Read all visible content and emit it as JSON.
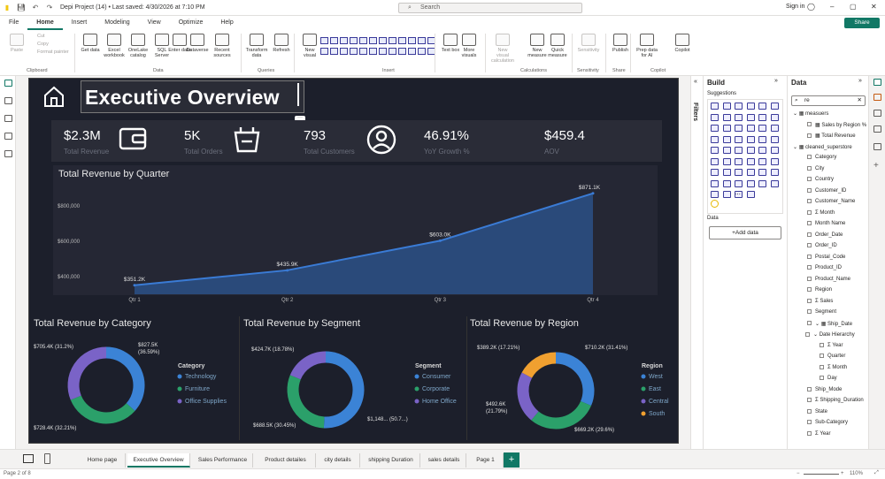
{
  "app": {
    "doc_title": "Depi Project (14) • Last saved: 4/30/2026 at 7:10 PM",
    "search_placeholder": "Search",
    "signin": "Sign in",
    "share": "Share"
  },
  "menu": [
    "File",
    "Home",
    "Insert",
    "Modeling",
    "View",
    "Optimize",
    "Help"
  ],
  "ribbon": {
    "buttons": [
      {
        "label": "Paste",
        "dis": true
      },
      {
        "label": "Cut",
        "dis": true
      },
      {
        "label": "Copy",
        "dis": true
      },
      {
        "label": "Format painter",
        "dis": true
      },
      {
        "label": "Get data",
        "dis": false
      },
      {
        "label": "Excel workbook",
        "dis": false
      },
      {
        "label": "OneLake catalog",
        "dis": false
      },
      {
        "label": "SQL Server",
        "dis": false
      },
      {
        "label": "Enter data",
        "dis": false
      },
      {
        "label": "Dataverse",
        "dis": false
      },
      {
        "label": "Recent sources",
        "dis": false
      },
      {
        "label": "Transform data",
        "dis": false
      },
      {
        "label": "Refresh",
        "dis": false
      },
      {
        "label": "New visual",
        "dis": false
      },
      {
        "label": "Text box",
        "dis": false
      },
      {
        "label": "More visuals",
        "dis": false
      },
      {
        "label": "New visual calculation",
        "dis": true
      },
      {
        "label": "New measure",
        "dis": false
      },
      {
        "label": "Quick measure",
        "dis": false
      },
      {
        "label": "Sensitivity",
        "dis": true
      },
      {
        "label": "Publish",
        "dis": false
      },
      {
        "label": "Prep data for AI",
        "dis": false
      },
      {
        "label": "Copilot",
        "dis": false
      }
    ],
    "groups": [
      "Clipboard",
      "Data",
      "Queries",
      "Insert",
      "Calculations",
      "Sensitivity",
      "Share",
      "Copilot"
    ]
  },
  "report": {
    "title": "Executive Overview",
    "kpis": [
      {
        "value": "$2.3M",
        "label": "Total Revenue",
        "icon": "wallet-icon"
      },
      {
        "value": "5K",
        "label": "Total Orders",
        "icon": "basket-icon"
      },
      {
        "value": "793",
        "label": "Total Customers",
        "icon": "user-icon"
      },
      {
        "value": "46.91%",
        "label": "YoY Growth %"
      },
      {
        "value": "$459.4",
        "label": "AOV"
      }
    ]
  },
  "chart_data": [
    {
      "type": "area",
      "title": "Total Revenue by Quarter",
      "categories": [
        "Qtr 1",
        "Qtr 2",
        "Qtr 3",
        "Qtr 4"
      ],
      "values": [
        351200,
        435900,
        603000,
        871100
      ],
      "data_labels": [
        "$351.2K",
        "$435.9K",
        "$603.0K",
        "$871.1K"
      ],
      "yticks": [
        "$400,000",
        "$600,000",
        "$800,000"
      ],
      "ylim": [
        300000,
        920000
      ],
      "color": "#3a7bd5"
    },
    {
      "type": "pie",
      "title": "Total Revenue by Category",
      "legend_title": "Category",
      "series": [
        {
          "name": "Technology",
          "value": 827500,
          "label": "$827.5K (36.59%)",
          "color": "#3b83d6"
        },
        {
          "name": "Furniture",
          "value": 728400,
          "label": "$728.4K (32.21%)",
          "color": "#2ba06a"
        },
        {
          "name": "Office Supplies",
          "value": 705400,
          "label": "$705.4K (31.2%)",
          "color": "#7a63c7"
        }
      ]
    },
    {
      "type": "pie",
      "title": "Total Revenue by Segment",
      "legend_title": "Segment",
      "series": [
        {
          "name": "Consumer",
          "value": 1148000,
          "label": "$1,148... (50.7...)",
          "color": "#3b83d6"
        },
        {
          "name": "Corporate",
          "value": 688500,
          "label": "$688.5K (30.45%)",
          "color": "#2ba06a"
        },
        {
          "name": "Home Office",
          "value": 424700,
          "label": "$424.7K (18.78%)",
          "color": "#7a63c7"
        }
      ]
    },
    {
      "type": "pie",
      "title": "Total Revenue by Region",
      "legend_title": "Region",
      "series": [
        {
          "name": "West",
          "value": 710200,
          "label": "$710.2K (31.41%)",
          "color": "#3b83d6"
        },
        {
          "name": "East",
          "value": 669200,
          "label": "$669.2K (29.6%)",
          "color": "#2ba06a"
        },
        {
          "name": "Central",
          "value": 492600,
          "label": "$492.6K (21.79%)",
          "color": "#7a63c7"
        },
        {
          "name": "South",
          "value": 389200,
          "label": "$389.2K (17.21%)",
          "color": "#f0a030"
        }
      ]
    }
  ],
  "build": {
    "title": "Build",
    "suggestions": "Suggestions",
    "data_label": "Data",
    "add_data": "+Add data"
  },
  "filters_label": "Filters",
  "data_pane": {
    "title": "Data",
    "search_value": "re",
    "items": [
      {
        "t": "measuers",
        "lvl": 0,
        "kind": "table"
      },
      {
        "t": "Sales by Region %",
        "lvl": 1,
        "kind": "measure"
      },
      {
        "t": "Total Revenue",
        "lvl": 1,
        "kind": "measure"
      },
      {
        "t": "cleaned_superstore",
        "lvl": 0,
        "kind": "table"
      },
      {
        "t": "Category",
        "lvl": 1
      },
      {
        "t": "City",
        "lvl": 1
      },
      {
        "t": "Country",
        "lvl": 1
      },
      {
        "t": "Customer_ID",
        "lvl": 1
      },
      {
        "t": "Customer_Name",
        "lvl": 1
      },
      {
        "t": "Month",
        "lvl": 1,
        "sigma": true
      },
      {
        "t": "Month Name",
        "lvl": 1
      },
      {
        "t": "Order_Date",
        "lvl": 1
      },
      {
        "t": "Order_ID",
        "lvl": 1
      },
      {
        "t": "Postal_Code",
        "lvl": 1
      },
      {
        "t": "Product_ID",
        "lvl": 1
      },
      {
        "t": "Product_Name",
        "lvl": 1
      },
      {
        "t": "Region",
        "lvl": 1
      },
      {
        "t": "Sales",
        "lvl": 1,
        "sigma": true
      },
      {
        "t": "Segment",
        "lvl": 1
      },
      {
        "t": "Ship_Date",
        "lvl": 1,
        "kind": "date"
      },
      {
        "t": "Date Hierarchy",
        "lvl": 2
      },
      {
        "t": "Year",
        "lvl": 3,
        "sigma": true
      },
      {
        "t": "Quarter",
        "lvl": 3
      },
      {
        "t": "Month",
        "lvl": 3,
        "sigma": true
      },
      {
        "t": "Day",
        "lvl": 3
      },
      {
        "t": "Ship_Mode",
        "lvl": 1
      },
      {
        "t": "Shipping_Duration",
        "lvl": 1,
        "sigma": true
      },
      {
        "t": "State",
        "lvl": 1
      },
      {
        "t": "Sub-Category",
        "lvl": 1
      },
      {
        "t": "Year",
        "lvl": 1,
        "sigma": true
      }
    ]
  },
  "tabs": [
    "Home page",
    "Executive Overview",
    "Sales Performance",
    "Product detailes",
    "city details",
    "shipping Duration",
    "sales details",
    "Page 1"
  ],
  "status": {
    "page": "Page 2 of 8",
    "zoom": "110%"
  }
}
